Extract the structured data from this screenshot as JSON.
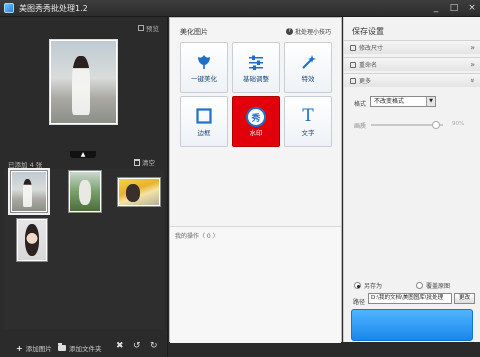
{
  "window": {
    "title": "美图秀秀批处理1.2",
    "controls": [
      "_",
      "□",
      "×"
    ]
  },
  "left": {
    "preview_label": "预览",
    "count_label": "已添加 4 张",
    "clear_label": "清空",
    "collapse_glyph": "▲",
    "tools": {
      "add_image": "添加图片",
      "add_folder": "添加文件夹",
      "delete_glyph": "✖",
      "rotate_left_glyph": "↺",
      "rotate_right_glyph": "↻"
    }
  },
  "center": {
    "section_title": "美化图片",
    "help_text": "批处理小技巧",
    "tiles": [
      {
        "label": "一键美化",
        "icon": "flower-icon"
      },
      {
        "label": "基础调整",
        "icon": "sliders-icon"
      },
      {
        "label": "特效",
        "icon": "magic-wand-icon"
      },
      {
        "label": "边框",
        "icon": "frame-icon"
      },
      {
        "label": "水印",
        "icon": "xiu-stamp-icon",
        "glyph": "秀",
        "active": true
      },
      {
        "label": "文字",
        "icon": "text-T-icon",
        "glyph": "T"
      }
    ],
    "ops_label": "我的操作（ 0 ）"
  },
  "right": {
    "title": "保存设置",
    "accordion": [
      {
        "label": "修改尺寸",
        "icon": "resize-icon",
        "chevron": "»"
      },
      {
        "label": "重命名",
        "icon": "rename-icon",
        "chevron": "»"
      },
      {
        "label": "更多",
        "icon": "more-icon",
        "chevron": "»"
      }
    ],
    "format_label": "格式",
    "format_value": "不改变格式",
    "quality_label": "画质",
    "quality_value": "90%",
    "quality_level": 0.9,
    "save_as_label": "另存为",
    "overwrite_label": "覆盖原图",
    "path_label": "路径",
    "path_value": "D:\\我的文档\\美图图库\\批处理",
    "change_label": "更改"
  },
  "colors": {
    "accent_red": "#e2000a",
    "save_blue": "#1a86ea",
    "tile_blue": "#1e6fc8"
  }
}
